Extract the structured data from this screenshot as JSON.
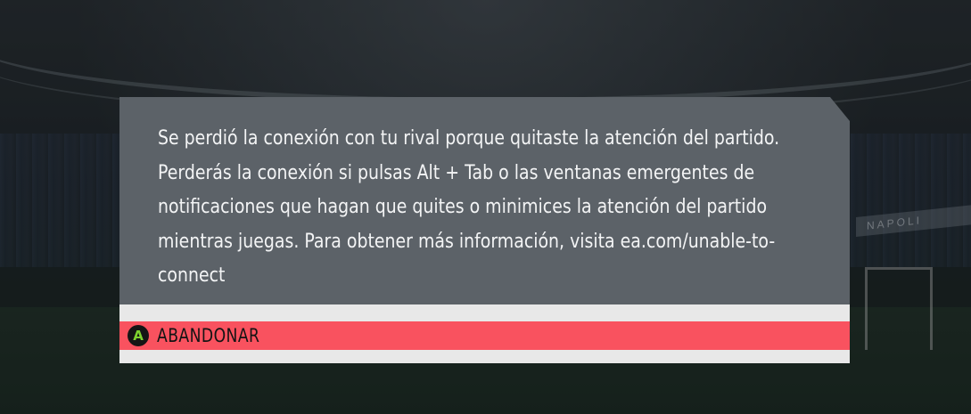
{
  "background": {
    "ad_board_text": "NAPOLI"
  },
  "dialog": {
    "message": "Se perdió la conexión con tu rival porque quitaste la atención del partido. Perderás la conexión si pulsas Alt + Tab o las ventanas emergentes de notificaciones que hagan que quites o minimices la atención del partido mientras juegas. Para obtener más información, visita ea.com/unable-to-connect",
    "message_lines": [
      "Se perdió la conexión con tu rival porque quitaste la atención del partido.",
      "Perderás la conexión si pulsas Alt + Tab o las ventanas emergentes de",
      "notificaciones que hagan que quites o minimices la atención del partido",
      "mientras juegas. Para obtener más información, visita ea.com/unable-to-",
      "connect"
    ],
    "action": {
      "button_glyph": "A",
      "label": "ABANDONAR"
    }
  },
  "colors": {
    "dialog_background": "#5c6268",
    "action_highlight": "#f9525f",
    "action_strip": "#e8e8e8",
    "a_button_glyph": "#7fd32f"
  }
}
